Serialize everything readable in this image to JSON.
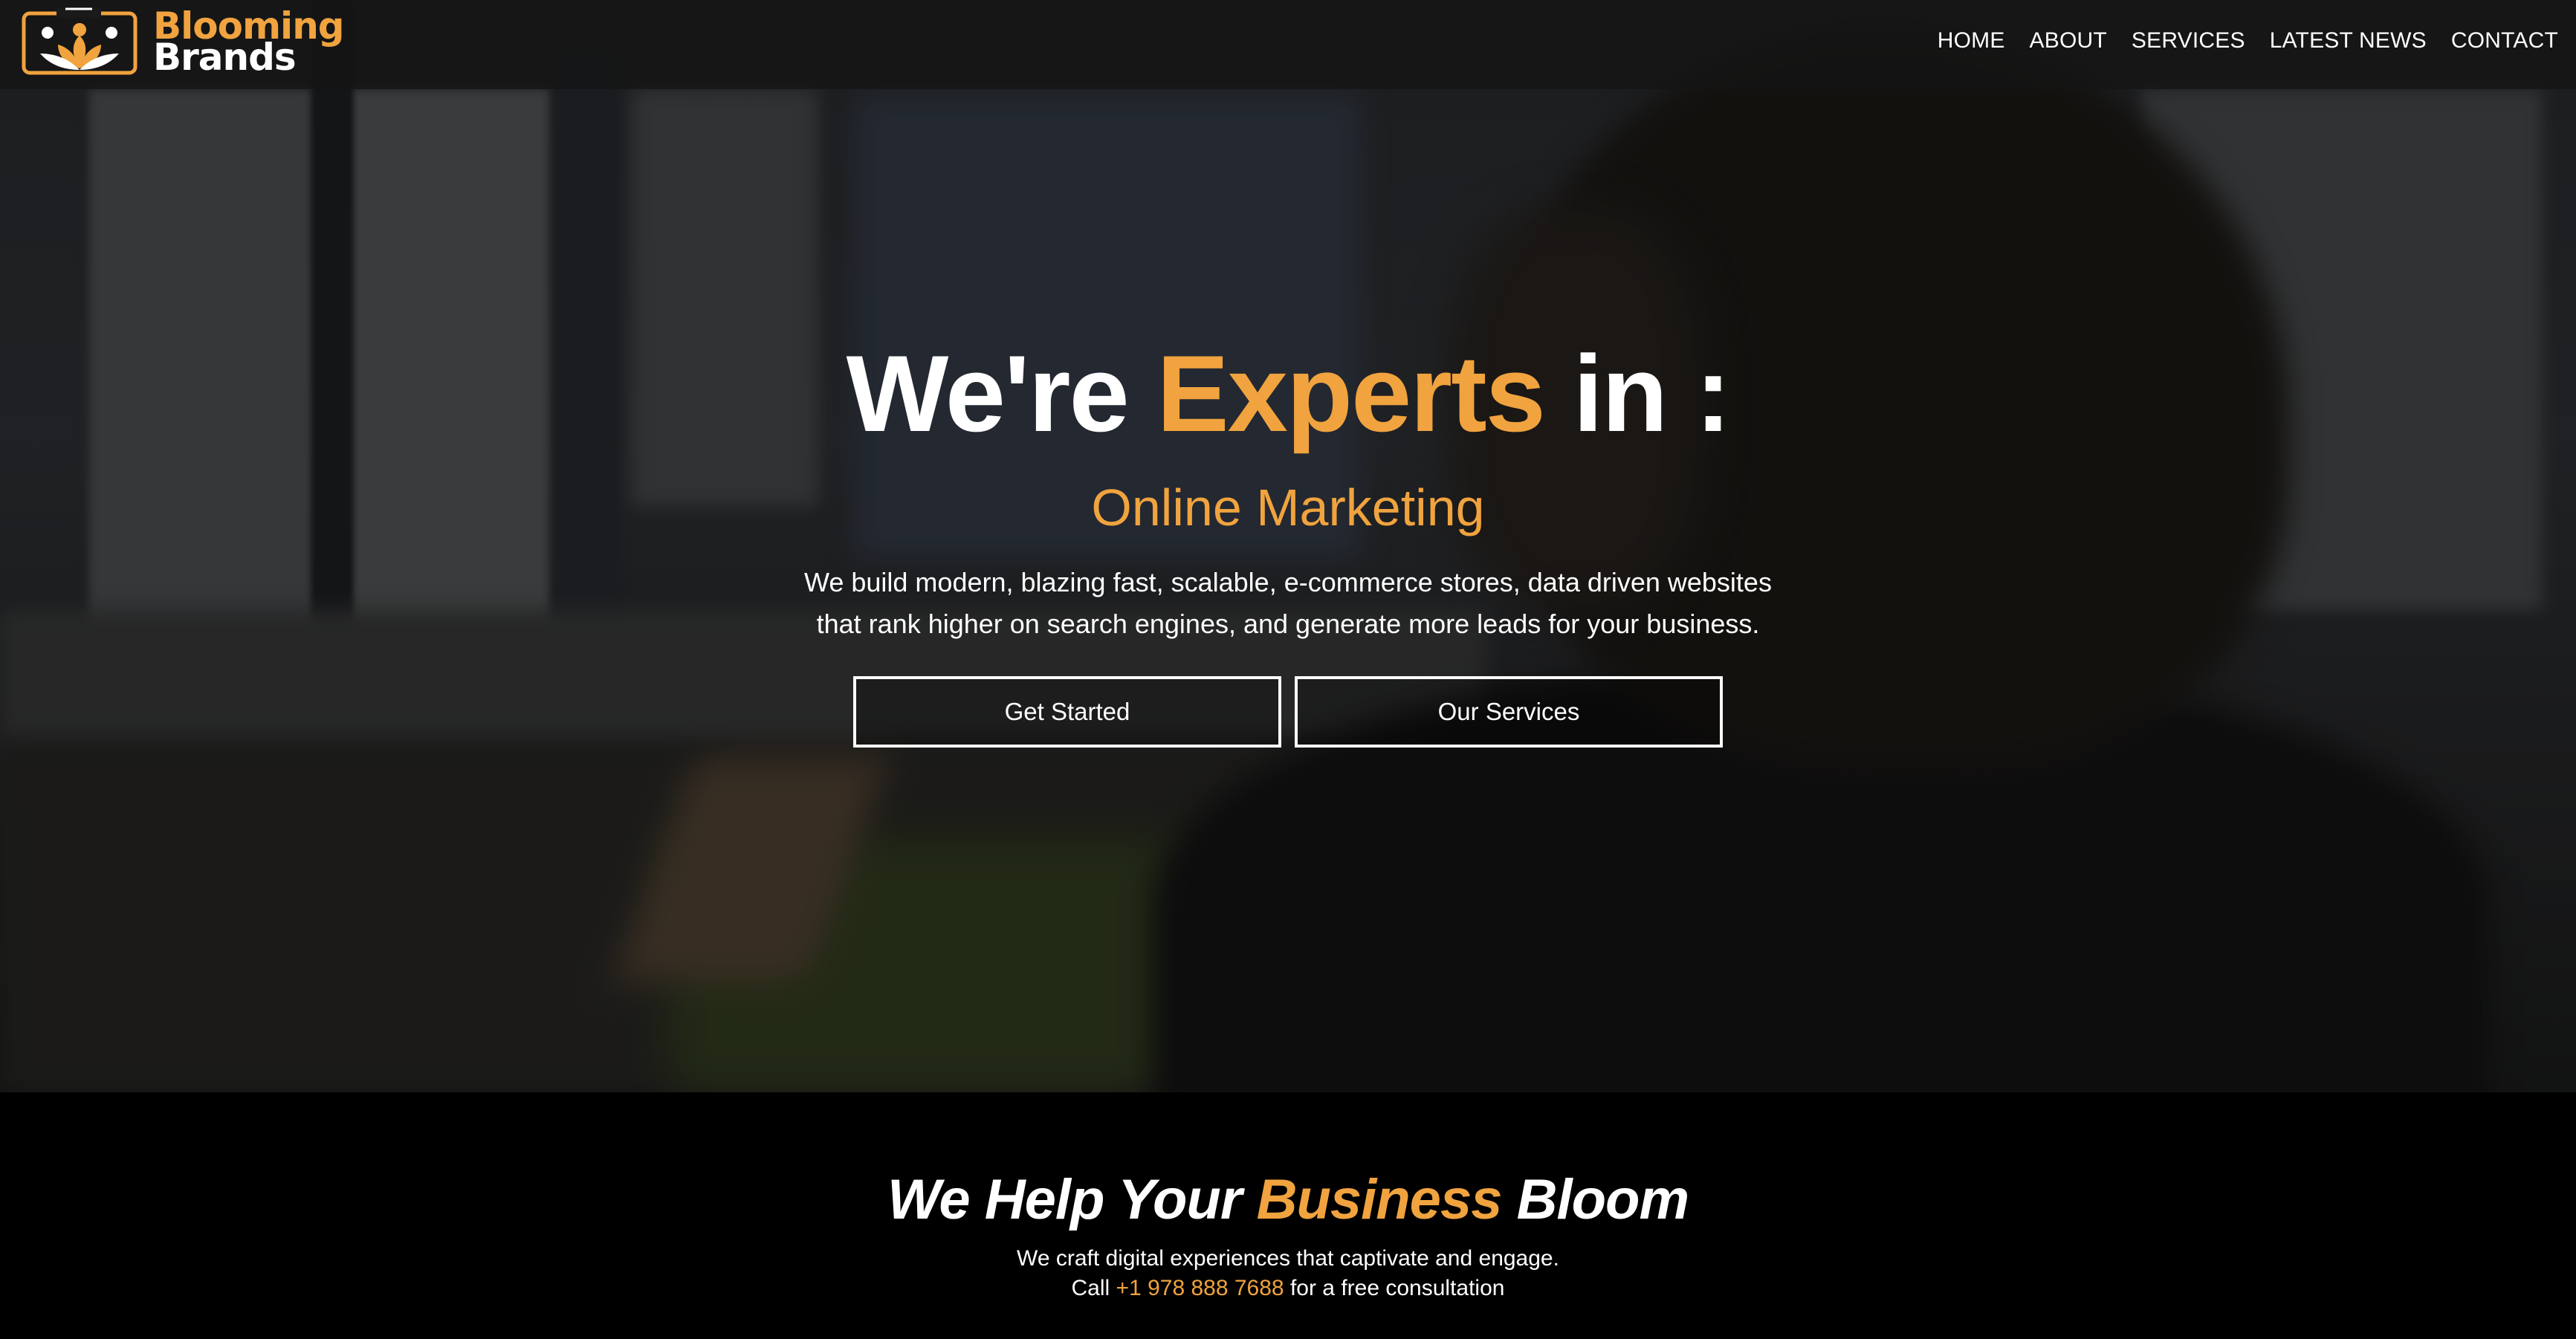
{
  "brand": {
    "line1": "Blooming",
    "line2": "Brands",
    "accent_color": "#f0a33e"
  },
  "nav": {
    "items": [
      {
        "label": "HOME"
      },
      {
        "label": "ABOUT"
      },
      {
        "label": "SERVICES"
      },
      {
        "label": "LATEST NEWS"
      },
      {
        "label": "CONTACT"
      }
    ]
  },
  "hero": {
    "headline_pre": "We're",
    "headline_accent": "Experts",
    "headline_post": "in :",
    "subhead": "Online Marketing",
    "description_line1": "We build modern, blazing fast, scalable, e-commerce stores, data driven websites",
    "description_line2": "that rank higher on search engines, and generate more leads for your business.",
    "primary_button": "Get Started",
    "secondary_button": "Our Services"
  },
  "bloom": {
    "title_pre": "We Help Your",
    "title_accent": "Business",
    "title_post": "Bloom",
    "line1": "We craft digital experiences that captivate and engage.",
    "call_pre": "Call",
    "phone": "+1 978 888 7688",
    "call_post": "for a free consultation"
  }
}
